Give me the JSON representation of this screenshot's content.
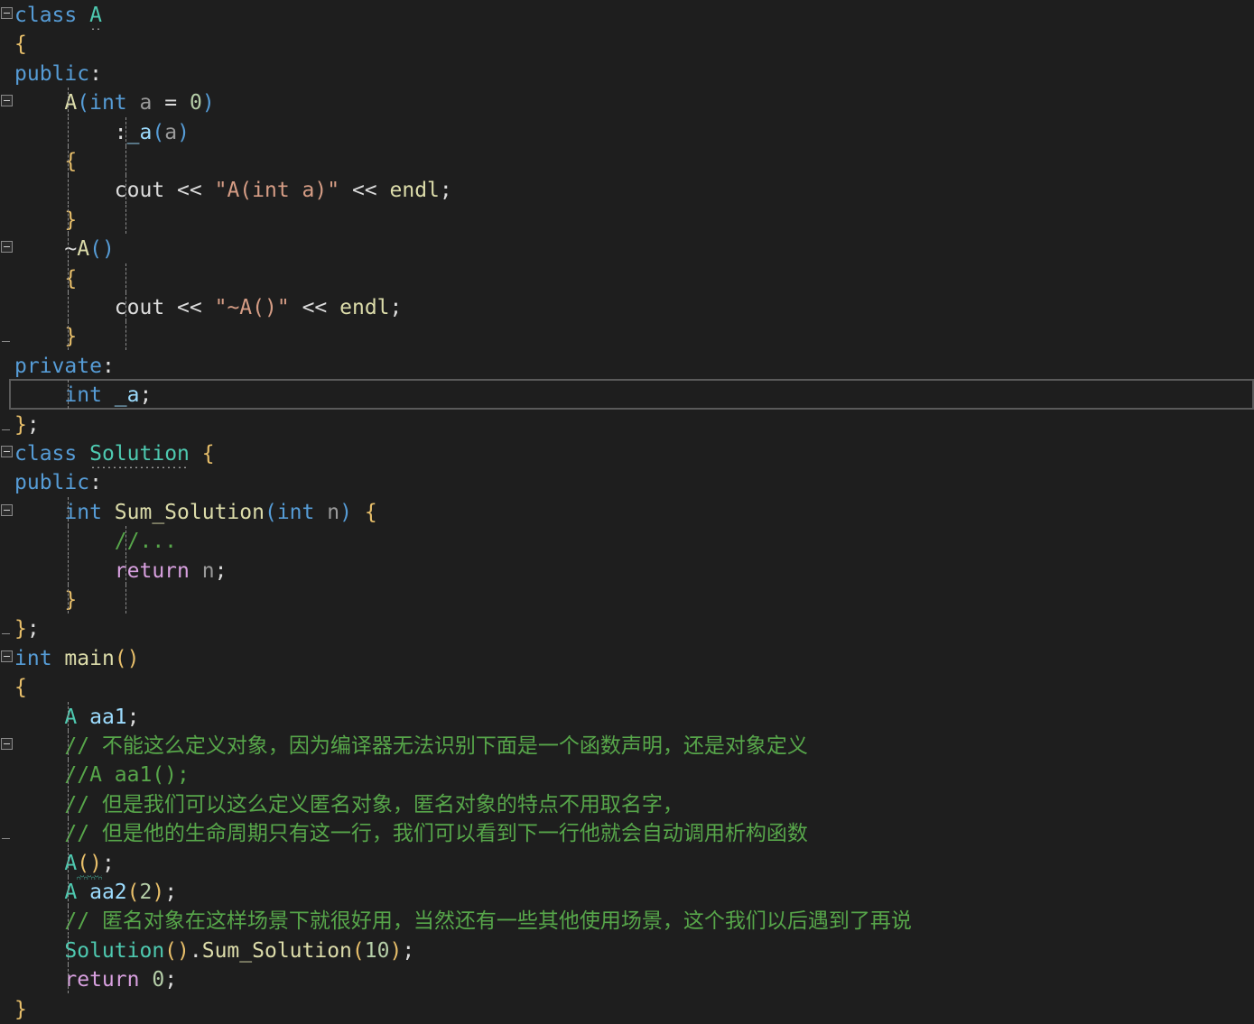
{
  "editor": {
    "language": "C++",
    "theme": "dark",
    "background_color": "#1e1e1e",
    "cursor_line_number": 14,
    "cursor_line_text": "    int _a;",
    "font_size_px": 23,
    "line_height_px": 32.4
  },
  "colors": {
    "keyword": "#569cd6",
    "control": "#d8a0df",
    "type": "#4ec9b0",
    "function": "#dcdcaa",
    "variable": "#9cdcfe",
    "parameter": "#9a9a9a",
    "number": "#b5cea8",
    "string": "#d69d85",
    "comment": "#57a64a",
    "brace": "#e8bf6a",
    "plain": "#dcdcdc",
    "cursor_line_border": "#5a5a5a",
    "indent_guide": "#8c8c8c",
    "fold_marker": "#8a8a8a"
  },
  "lines": [
    {
      "n": 1,
      "indent_guides": [],
      "fold": "open",
      "html": "<span class=\"kw\">class</span> <span class=\"type dotline\">A</span>"
    },
    {
      "n": 2,
      "indent_guides": [],
      "fold": null,
      "html": "<span class=\"brace1\">{</span>"
    },
    {
      "n": 3,
      "indent_guides": [],
      "fold": null,
      "html": "<span class=\"kw\">public</span><span class=\"plain\">:</span>"
    },
    {
      "n": 4,
      "indent_guides": [
        32
      ],
      "fold": "open",
      "html": "    <span class=\"fn\">A</span><span class=\"paren\">(</span><span class=\"kw\">int</span> <span class=\"param\">a</span> <span class=\"plain\">=</span> <span class=\"num\">0</span><span class=\"paren\">)</span>"
    },
    {
      "n": 5,
      "indent_guides": [
        32,
        64
      ],
      "fold": null,
      "html": "        <span class=\"plain\">:</span><span class=\"var\">_a</span><span class=\"paren\">(</span><span class=\"param\">a</span><span class=\"paren\">)</span>"
    },
    {
      "n": 6,
      "indent_guides": [
        32,
        64
      ],
      "fold": null,
      "html": "    <span class=\"brace1\">{</span>"
    },
    {
      "n": 7,
      "indent_guides": [
        32,
        64
      ],
      "fold": null,
      "html": "        <span class=\"plain\">cout</span> <span class=\"plain\">&lt;&lt;</span> <span class=\"quote\">\"</span><span class=\"str\">A(int a)</span><span class=\"quote\">\"</span> <span class=\"plain\">&lt;&lt;</span> <span class=\"fn\">endl</span><span class=\"plain\">;</span>"
    },
    {
      "n": 8,
      "indent_guides": [
        32,
        64
      ],
      "fold": null,
      "html": "    <span class=\"brace1\">}</span>"
    },
    {
      "n": 9,
      "indent_guides": [
        32
      ],
      "fold": "open",
      "html": "    <span class=\"plain\">~</span><span class=\"fn\">A</span><span class=\"paren\">()</span>"
    },
    {
      "n": 10,
      "indent_guides": [
        32,
        64
      ],
      "fold": null,
      "html": "    <span class=\"brace1\">{</span>"
    },
    {
      "n": 11,
      "indent_guides": [
        32,
        64
      ],
      "fold": null,
      "html": "        <span class=\"plain\">cout</span> <span class=\"plain\">&lt;&lt;</span> <span class=\"quote\">\"</span><span class=\"str\">~A()</span><span class=\"quote\">\"</span> <span class=\"plain\">&lt;&lt;</span> <span class=\"fn\">endl</span><span class=\"plain\">;</span>"
    },
    {
      "n": 12,
      "indent_guides": [
        32,
        64
      ],
      "fold": "close",
      "html": "    <span class=\"brace1\">}</span>"
    },
    {
      "n": 13,
      "indent_guides": [],
      "fold": null,
      "html": "<span class=\"kw\">private</span><span class=\"plain\">:</span>"
    },
    {
      "n": 14,
      "indent_guides": [
        32
      ],
      "fold": null,
      "cursor": true,
      "html": "    <span class=\"kw\">int</span> <span class=\"var\">_a</span><span class=\"plain\">;</span>"
    },
    {
      "n": 15,
      "indent_guides": [],
      "fold": "close",
      "html": "<span class=\"brace1\">}</span><span class=\"plain\">;</span>"
    },
    {
      "n": 16,
      "indent_guides": [],
      "fold": "open",
      "html": "<span class=\"kw\">class</span> <span class=\"type dotline\">Solution</span> <span class=\"brace1\">{</span>"
    },
    {
      "n": 17,
      "indent_guides": [],
      "fold": null,
      "html": "<span class=\"kw\">public</span><span class=\"plain\">:</span>"
    },
    {
      "n": 18,
      "indent_guides": [
        32
      ],
      "fold": "open",
      "html": "    <span class=\"kw\">int</span> <span class=\"fn\">Sum_Solution</span><span class=\"paren\">(</span><span class=\"kw\">int</span> <span class=\"param\">n</span><span class=\"paren\">)</span> <span class=\"brace1\">{</span>"
    },
    {
      "n": 19,
      "indent_guides": [
        32,
        64
      ],
      "fold": null,
      "html": "        <span class=\"cmt\">//...</span>"
    },
    {
      "n": 20,
      "indent_guides": [
        32,
        64
      ],
      "fold": null,
      "html": "        <span class=\"ctl\">return</span> <span class=\"param\">n</span><span class=\"plain\">;</span>"
    },
    {
      "n": 21,
      "indent_guides": [
        32,
        64
      ],
      "fold": null,
      "html": "    <span class=\"brace1\">}</span>"
    },
    {
      "n": 22,
      "indent_guides": [],
      "fold": "close",
      "html": "<span class=\"brace1\">}</span><span class=\"plain\">;</span>"
    },
    {
      "n": 23,
      "indent_guides": [],
      "fold": "open",
      "html": "<span class=\"kw\">int</span> <span class=\"fn\">main</span><span class=\"paren2\">()</span>"
    },
    {
      "n": 24,
      "indent_guides": [],
      "fold": null,
      "html": "<span class=\"brace1\">{</span>"
    },
    {
      "n": 25,
      "indent_guides": [
        32
      ],
      "fold": null,
      "html": "    <span class=\"type\">A</span> <span class=\"var\">aa1</span><span class=\"plain\">;</span>"
    },
    {
      "n": 26,
      "indent_guides": [
        32
      ],
      "fold": "open",
      "html": "    <span class=\"cmt\">// 不能这么定义对象，因为编译器无法识别下面是一个函数声明，还是对象定义</span>"
    },
    {
      "n": 27,
      "indent_guides": [
        32
      ],
      "fold": null,
      "html": "    <span class=\"cmt\">//A aa1();</span>"
    },
    {
      "n": 28,
      "indent_guides": [
        32
      ],
      "fold": null,
      "html": "    <span class=\"cmt\">// 但是我们可以这么定义匿名对象，匿名对象的特点不用取名字，</span>"
    },
    {
      "n": 29,
      "indent_guides": [
        32
      ],
      "fold": "close",
      "html": "    <span class=\"cmt\">// 但是他的生命周期只有这一行，我们可以看到下一行他就会自动调用析构函数</span>"
    },
    {
      "n": 30,
      "indent_guides": [
        32
      ],
      "fold": null,
      "html": "    <span class=\"type\">A</span><span class=\"paren2 squiggle\">()</span><span class=\"plain\">;</span>"
    },
    {
      "n": 31,
      "indent_guides": [
        32
      ],
      "fold": null,
      "html": "    <span class=\"type\">A</span> <span class=\"var\">aa2</span><span class=\"paren2\">(</span><span class=\"num\">2</span><span class=\"paren2\">)</span><span class=\"plain\">;</span>"
    },
    {
      "n": 32,
      "indent_guides": [
        32
      ],
      "fold": null,
      "html": "    <span class=\"cmt\">// 匿名对象在这样场景下就很好用，当然还有一些其他使用场景，这个我们以后遇到了再说</span>"
    },
    {
      "n": 33,
      "indent_guides": [
        32
      ],
      "fold": null,
      "html": "    <span class=\"type\">Solution</span><span class=\"paren2\">()</span><span class=\"plain\">.</span><span class=\"fn\">Sum_Solution</span><span class=\"paren2\">(</span><span class=\"num\">10</span><span class=\"paren2\">)</span><span class=\"plain\">;</span>"
    },
    {
      "n": 34,
      "indent_guides": [
        32
      ],
      "fold": null,
      "html": "    <span class=\"ctl\">return</span> <span class=\"num\">0</span><span class=\"plain\">;</span>"
    },
    {
      "n": 35,
      "indent_guides": [],
      "fold": null,
      "html": "<span class=\"brace1\">}</span>"
    }
  ],
  "code_plain_text": [
    "class A",
    "{",
    "public:",
    "    A(int a = 0)",
    "        :_a(a)",
    "    {",
    "        cout << \"A(int a)\" << endl;",
    "    }",
    "    ~A()",
    "    {",
    "        cout << \"~A()\" << endl;",
    "    }",
    "private:",
    "    int _a;",
    "};",
    "class Solution {",
    "public:",
    "    int Sum_Solution(int n) {",
    "        //...",
    "        return n;",
    "    }",
    "};",
    "int main()",
    "{",
    "    A aa1;",
    "    // 不能这么定义对象，因为编译器无法识别下面是一个函数声明，还是对象定义",
    "    //A aa1();",
    "    // 但是我们可以这么定义匿名对象，匿名对象的特点不用取名字，",
    "    // 但是他的生命周期只有这一行，我们可以看到下一行他就会自动调用析构函数",
    "    A();",
    "    A aa2(2);",
    "    // 匿名对象在这样场景下就很好用，当然还有一些其他使用场景，这个我们以后遇到了再说",
    "    Solution().Sum_Solution(10);",
    "    return 0;",
    "}"
  ]
}
